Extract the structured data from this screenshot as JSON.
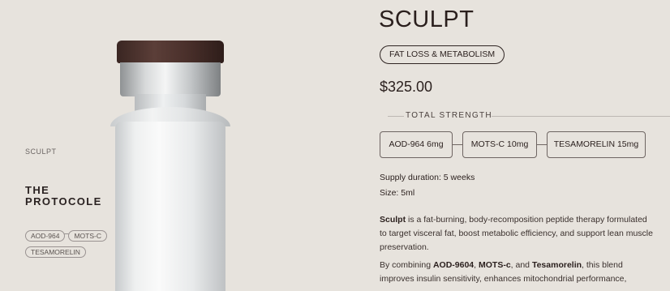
{
  "vial": {
    "brand": "SCULPT",
    "title_line1": "THE",
    "title_line2": "PROTOCOLE",
    "pills": [
      "AOD-964",
      "MOTS-C",
      "TESAMORELIN"
    ]
  },
  "product": {
    "name": "SCULPT",
    "category": "FAT LOSS & METABOLISM",
    "price": "$325.00",
    "strength_label": "TOTAL STRENGTH",
    "ingredients": [
      "AOD-964 6mg",
      "MOTS-C 10mg",
      "TESAMORELIN 15mg"
    ],
    "supply": "Supply duration: 5 weeks",
    "size": "Size: 5ml",
    "desc1": {
      "bold": "Sculpt",
      "rest": " is a fat-burning, body-recomposition peptide therapy formulated to target visceral fat, boost metabolic efficiency, and support lean muscle preservation."
    },
    "desc2": {
      "prefix": "By combining ",
      "b1": "AOD-9604",
      "sep1": ", ",
      "b2": "MOTS-c",
      "sep2": ", and ",
      "b3": "Tesamorelin",
      "rest": ", this blend improves insulin sensitivity, enhances mitochondrial performance,"
    }
  },
  "colors": {
    "background": "#e7e3dd",
    "cap": "#4a302b",
    "text": "#2a1f1d"
  }
}
